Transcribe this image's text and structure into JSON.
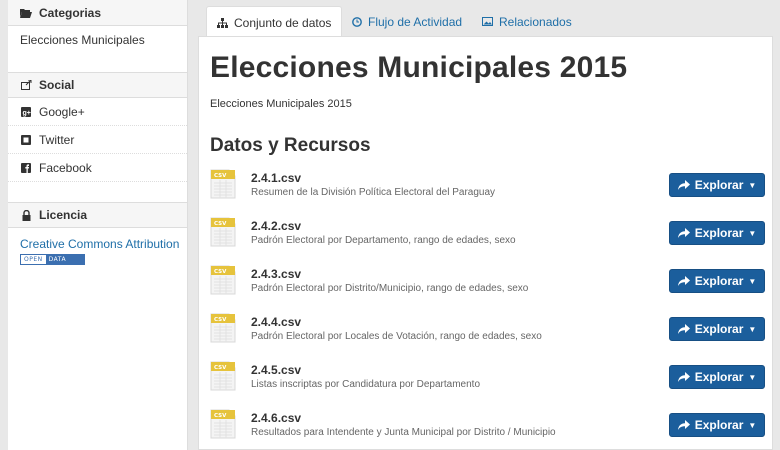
{
  "sidebar": {
    "categories": {
      "heading": "Categorias",
      "items": [
        "Elecciones Municipales"
      ]
    },
    "social": {
      "heading": "Social",
      "items": [
        "Google+",
        "Twitter",
        "Facebook"
      ]
    },
    "license": {
      "heading": "Licencia",
      "link": "Creative Commons Attribution",
      "badge_left": "OPEN",
      "badge_right": "DATA"
    }
  },
  "tabs": [
    {
      "label": "Conjunto de datos",
      "icon": "sitemap-icon",
      "active": true
    },
    {
      "label": "Flujo de Actividad",
      "icon": "clock-icon",
      "active": false
    },
    {
      "label": "Relacionados",
      "icon": "picture-icon",
      "active": false
    }
  ],
  "main": {
    "title": "Elecciones Municipales 2015",
    "subtitle": "Elecciones Municipales 2015",
    "section_title": "Datos y Recursos",
    "explore_label": "Explorar",
    "file_badge": "CSV",
    "resources": [
      {
        "name": "2.4.1.csv",
        "description": "Resumen de la División Política Electoral del Paraguay"
      },
      {
        "name": "2.4.2.csv",
        "description": "Padrón Electoral por Departamento, rango de edades, sexo"
      },
      {
        "name": "2.4.3.csv",
        "description": "Padrón Electoral por Distrito/Municipio, rango de edades, sexo"
      },
      {
        "name": "2.4.4.csv",
        "description": "Padrón Electoral por Locales de Votación, rango de edades, sexo"
      },
      {
        "name": "2.4.5.csv",
        "description": "Listas inscriptas por Candidatura por Departamento"
      },
      {
        "name": "2.4.6.csv",
        "description": "Resultados para Intendente y Junta Municipal por Distrito / Municipio"
      }
    ]
  },
  "colors": {
    "link": "#1f6fa8",
    "button": "#1b5e9c",
    "file_icon": "#e6c33c"
  }
}
